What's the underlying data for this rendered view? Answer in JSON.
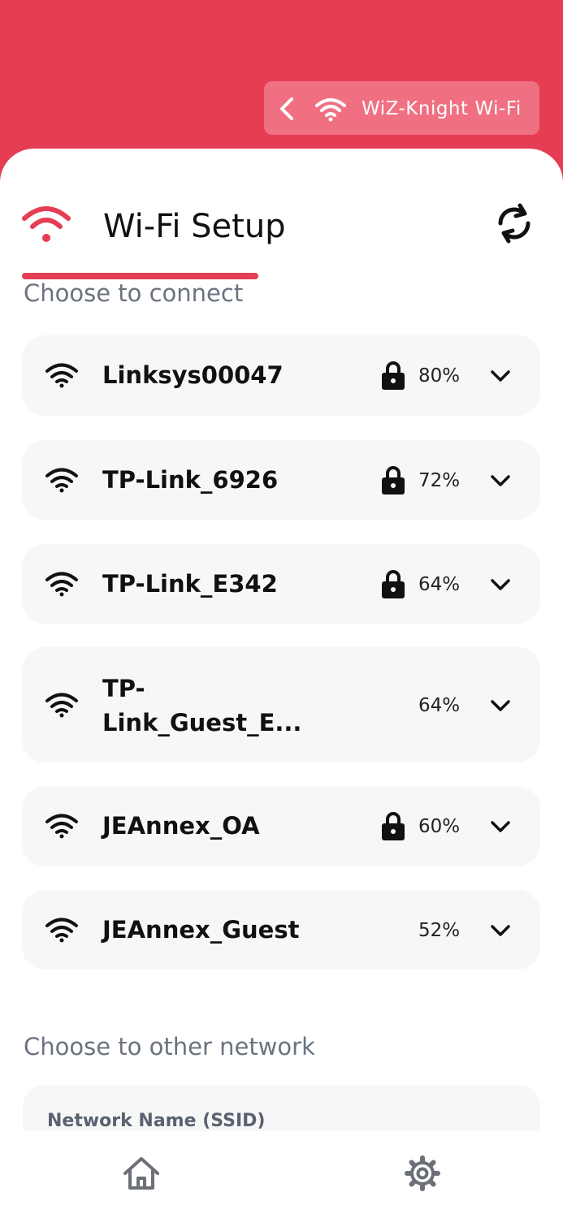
{
  "header": {
    "title": "WiZ-Knight Wi-Fi"
  },
  "setup": {
    "title": "Wi-Fi Setup",
    "subtitle": "Choose to connect"
  },
  "networks": [
    {
      "name": "Linksys00047",
      "signal": "80%",
      "locked": true
    },
    {
      "name": "TP-Link_6926",
      "signal": "72%",
      "locked": true
    },
    {
      "name": "TP-Link_E342",
      "signal": "64%",
      "locked": true
    },
    {
      "name": "TP-\nLink_Guest_E...",
      "signal": "64%",
      "locked": false
    },
    {
      "name": "JEAnnex_OA",
      "signal": "60%",
      "locked": true
    },
    {
      "name": "JEAnnex_Guest",
      "signal": "52%",
      "locked": false
    }
  ],
  "other": {
    "label": "Choose to other network",
    "ssid_label": "Network Name (SSID)"
  },
  "icons": {
    "back": "chevron-left-icon",
    "wifi": "wifi-icon",
    "refresh": "refresh-icon",
    "lock": "lock-icon",
    "expand": "chevron-down-icon",
    "home": "home-icon",
    "settings": "gear-icon"
  },
  "colors": {
    "accent": "#e53e54",
    "pill": "#f07082",
    "card": "#f7f7f7"
  }
}
